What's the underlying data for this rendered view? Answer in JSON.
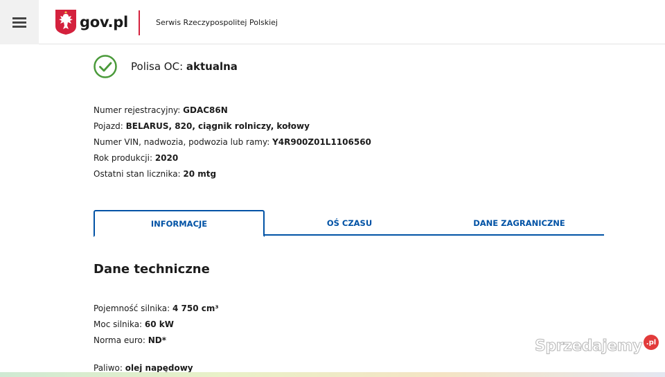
{
  "header": {
    "menu_icon": "hamburger-icon",
    "logo_text": "gov.pl",
    "service_name": "Serwis Rzeczypospolitej Polskiej",
    "accent_color": "#d4213d"
  },
  "status": {
    "icon": "check-circle-icon",
    "label": "Polisa OC: ",
    "value": "aktualna",
    "color": "#4a9a3a"
  },
  "vehicle": {
    "reg_label": "Numer rejestracyjny: ",
    "reg_value": "GDAC86N",
    "vehicle_label": "Pojazd: ",
    "vehicle_value": "BELARUS, 820, ciągnik rolniczy, kołowy",
    "vin_label": "Numer VIN, nadwozia, podwozia lub ramy: ",
    "vin_value": "Y4R900Z01L1106560",
    "year_label": "Rok produkcji: ",
    "year_value": "2020",
    "meter_label": "Ostatni stan licznika: ",
    "meter_value": "20 mtg"
  },
  "tabs": {
    "active": "INFORMACJE",
    "second": "OŚ CZASU",
    "third": "DANE ZAGRANICZNE",
    "color": "#0052a5"
  },
  "technical": {
    "title": "Dane techniczne",
    "engine_label": "Pojemność silnika: ",
    "engine_value": "4 750 cm³",
    "power_label": "Moc silnika: ",
    "power_value": "60 kW",
    "euro_label": "Norma euro: ",
    "euro_value": "ND*",
    "fuel_label": "Paliwo: ",
    "fuel_value": "olej napędowy"
  },
  "watermark": {
    "text": "Sprzedajemy",
    "badge": ".pl"
  }
}
